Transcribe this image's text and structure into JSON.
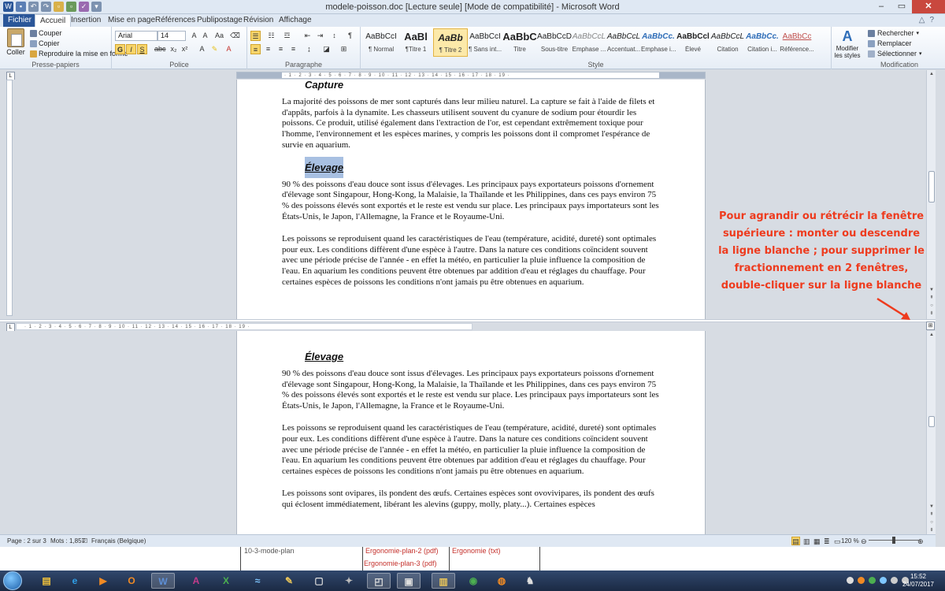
{
  "window": {
    "title": "modele-poisson.doc [Lecture seule] [Mode de compatibilité] - Microsoft Word"
  },
  "tabs": [
    "Fichier",
    "Accueil",
    "Insertion",
    "Mise en page",
    "Références",
    "Publipostage",
    "Révision",
    "Affichage"
  ],
  "clipboard": {
    "paste": "Coller",
    "cut": "Couper",
    "copy": "Copier",
    "format_painter": "Reproduire la mise en forme",
    "label": "Presse-papiers"
  },
  "font": {
    "name": "Arial",
    "size": "14",
    "label": "Police",
    "bold": "G",
    "italic": "I",
    "underline": "S"
  },
  "paragraph": {
    "label": "Paragraphe"
  },
  "styles": {
    "label": "Style",
    "items": [
      {
        "preview": "AaBbCcI",
        "name": "¶ Normal"
      },
      {
        "preview": "AaBl",
        "name": "¶Titre 1"
      },
      {
        "preview": "AaBb",
        "name": "¶ Titre 2"
      },
      {
        "preview": "AaBbCcI",
        "name": "¶ Sans int..."
      },
      {
        "preview": "AaBbC",
        "name": "Titre"
      },
      {
        "preview": "AaBbCcD",
        "name": "Sous-titre"
      },
      {
        "preview": "AaBbCcL",
        "name": "Emphase ..."
      },
      {
        "preview": "AaBbCcL",
        "name": "Accentuat..."
      },
      {
        "preview": "AaBbCc.",
        "name": "Emphase i..."
      },
      {
        "preview": "AaBbCcl",
        "name": "Élevé"
      },
      {
        "preview": "AaBbCcL",
        "name": "Citation"
      },
      {
        "preview": "AaBbCc.",
        "name": "Citation i..."
      },
      {
        "preview": "AaBbCc",
        "name": "Référence..."
      }
    ],
    "modify": "Modifier les styles"
  },
  "editing": {
    "find": "Rechercher",
    "replace": "Remplacer",
    "select": "Sélectionner",
    "label": "Modification"
  },
  "document": {
    "top": {
      "heading_capture": "Capture",
      "para_capture": "La majorité des poissons de mer sont capturés dans leur milieu naturel. La capture se fait à l'aide de filets et d'appâts, parfois à la dynamite. Les chasseurs utilisent souvent du cyanure de sodium pour étourdir les poissons. Ce produit, utilisé également dans l'extraction de l'or, est cependant extrêmement toxique pour l'homme, l'environnement et les espèces marines, y compris les poissons dont il compromet l'espérance de survie en aquarium.",
      "heading_elevage": "Élevage",
      "para_elevage": "90 % des poissons d'eau douce sont issus d'élevages. Les principaux pays exportateurs poissons d'ornement d'élevage sont Singapour, Hong-Kong, la Malaisie, la Thaïlande et les Philippines, dans ces pays environ 75 % des poissons élevés sont exportés et le reste est vendu sur place. Les principaux pays importateurs sont les États-Unis, le Japon, l'Allemagne, la France et le Royaume-Uni.",
      "para_repro": "Les poissons se reproduisent quand les caractéristiques de l'eau (température, acidité, dureté) sont optimales pour eux. Les conditions diffèrent d'une espèce à l'autre. Dans la nature ces conditions coïncident souvent avec une période précise de l'année - en effet la météo, en particulier la pluie influence la composition de l'eau. En aquarium les conditions peuvent être obtenues par addition d'eau et réglages du chauffage. Pour certaines espèces de poissons les conditions n'ont jamais pu être obtenues en aquarium."
    },
    "bottom": {
      "heading_elevage": "Élevage",
      "para_elevage": "90 % des poissons d'eau douce sont issus d'élevages. Les principaux pays exportateurs poissons d'ornement d'élevage sont Singapour, Hong-Kong, la Malaisie, la Thaïlande et les Philippines, dans ces pays environ 75 % des poissons élevés sont exportés et le reste est vendu sur place. Les principaux pays importateurs sont les États-Unis, le Japon, l'Allemagne, la France et le Royaume-Uni.",
      "para_repro": "Les poissons se reproduisent quand les caractéristiques de l'eau (température, acidité, dureté) sont optimales pour eux. Les conditions diffèrent d'une espèce à l'autre. Dans la nature ces conditions coïncident souvent avec une période précise de l'année - en effet la météo, en particulier la pluie influence la composition de l'eau. En aquarium les conditions peuvent être obtenues par addition d'eau et réglages du chauffage. Pour certaines espèces de poissons les conditions n'ont jamais pu être obtenues en aquarium.",
      "para_ovi": "Les poissons sont ovipares, ils pondent des œufs. Certaines espèces sont ovovivipares, ils pondent des œufs qui éclosent immédiatement, libérant les alevins (guppy, molly, platy...). Certaines espèces"
    }
  },
  "annotation": "Pour agrandir ou rétrécir la fenêtre supérieure : monter ou descendre la ligne blanche ; pour supprimer le fractionnement en 2 fenêtres, double-cliquer sur la ligne blanche",
  "status": {
    "page": "Page : 2 sur 3",
    "words": "Mots : 1,857",
    "language": "Français (Belgique)",
    "zoom": "120 %"
  },
  "background": {
    "item1": "10-3-mode-plan",
    "item2": "Ergonomie-plan-2 (pdf)",
    "item3": "Ergonomie-plan-3 (pdf)",
    "item4": "Ergonomie (txt)"
  },
  "taskbar": {
    "time": "15:52",
    "date": "24/07/2017"
  },
  "colors": {
    "accent": "#2a5699",
    "annotation": "#ee3b1e"
  }
}
